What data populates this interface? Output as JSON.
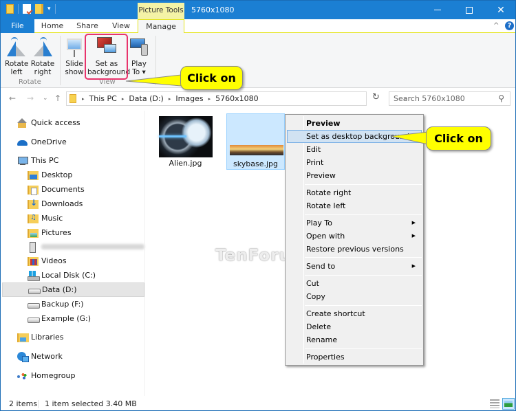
{
  "window": {
    "title": "5760x1080",
    "contextual_tab_group": "Picture Tools",
    "controls": {
      "minimize": "minimize",
      "maximize": "maximize",
      "close": "✕"
    }
  },
  "quick_access_toolbar": {
    "dropdown": "▾"
  },
  "ribbon": {
    "tabs": [
      {
        "label": "File"
      },
      {
        "label": "Home"
      },
      {
        "label": "Share"
      },
      {
        "label": "View"
      },
      {
        "label": "Manage",
        "active": true
      }
    ],
    "collapse_glyph": "^",
    "help_glyph": "?",
    "groups": [
      {
        "label": "Rotate",
        "buttons": [
          {
            "line1": "Rotate",
            "line2": "left",
            "icon": "rotate-left-icon"
          },
          {
            "line1": "Rotate",
            "line2": "right",
            "icon": "rotate-right-icon"
          }
        ]
      },
      {
        "label": "View",
        "buttons": [
          {
            "line1": "Slide",
            "line2": "show",
            "icon": "slideshow-icon"
          },
          {
            "line1": "Set as",
            "line2": "background",
            "icon": "set-background-icon",
            "highlighted": true
          },
          {
            "line1": "Play",
            "line2": "To ▾",
            "icon": "play-to-icon"
          }
        ]
      }
    ]
  },
  "callouts": [
    {
      "text": "Click on",
      "target": "Set as background"
    },
    {
      "text": "Click on",
      "target": "Set as desktop background"
    }
  ],
  "navigation": {
    "back": "←",
    "forward": "→",
    "recent": "⌄",
    "up": "↑",
    "breadcrumb": [
      "This PC",
      "Data (D:)",
      "Images",
      "5760x1080"
    ],
    "crumb_separator": "▸",
    "address_dropdown": "⌄",
    "refresh": "↻",
    "search_placeholder": "Search 5760x1080",
    "search_glyph": "⚲"
  },
  "nav_pane": {
    "items": [
      {
        "label": "Quick access",
        "icon": "quick-access-icon",
        "level": 0
      },
      {
        "label": "OneDrive",
        "icon": "onedrive-icon",
        "level": 0
      },
      {
        "label": "This PC",
        "icon": "this-pc-icon",
        "level": 0
      },
      {
        "label": "Desktop",
        "icon": "desktop-folder-icon",
        "level": 1
      },
      {
        "label": "Documents",
        "icon": "documents-folder-icon",
        "level": 1
      },
      {
        "label": "Downloads",
        "icon": "downloads-folder-icon",
        "level": 1
      },
      {
        "label": "Music",
        "icon": "music-folder-icon",
        "level": 1
      },
      {
        "label": "Pictures",
        "icon": "pictures-folder-icon",
        "level": 1
      },
      {
        "label": "",
        "icon": "phone-device-icon",
        "level": 1,
        "blurred": true
      },
      {
        "label": "Videos",
        "icon": "videos-folder-icon",
        "level": 1
      },
      {
        "label": "Local Disk (C:)",
        "icon": "local-disk-icon",
        "level": 1
      },
      {
        "label": "Data (D:)",
        "icon": "drive-icon",
        "level": 1,
        "selected": true
      },
      {
        "label": "Backup (F:)",
        "icon": "drive-icon",
        "level": 1
      },
      {
        "label": "Example (G:)",
        "icon": "drive-icon",
        "level": 1
      },
      {
        "label": "Libraries",
        "icon": "libraries-icon",
        "level": 0
      },
      {
        "label": "Network",
        "icon": "network-icon",
        "level": 0
      },
      {
        "label": "Homegroup",
        "icon": "homegroup-icon",
        "level": 0
      }
    ]
  },
  "files": [
    {
      "name": "Alien.jpg",
      "selected": false
    },
    {
      "name": "skybase.jpg",
      "selected": true
    }
  ],
  "context_menu": {
    "items": [
      {
        "label": "Preview",
        "bold": true
      },
      {
        "label": "Set as desktop background",
        "hover": true
      },
      {
        "label": "Edit"
      },
      {
        "label": "Print"
      },
      {
        "label": "Preview"
      },
      {
        "separator": true
      },
      {
        "label": "Rotate right"
      },
      {
        "label": "Rotate left"
      },
      {
        "separator": true
      },
      {
        "label": "Play To",
        "submenu": true
      },
      {
        "label": "Open with",
        "submenu": true
      },
      {
        "label": "Restore previous versions"
      },
      {
        "separator": true
      },
      {
        "label": "Send to",
        "submenu": true
      },
      {
        "separator": true
      },
      {
        "label": "Cut"
      },
      {
        "label": "Copy"
      },
      {
        "separator": true
      },
      {
        "label": "Create shortcut"
      },
      {
        "label": "Delete"
      },
      {
        "label": "Rename"
      },
      {
        "separator": true
      },
      {
        "label": "Properties"
      }
    ],
    "submenu_glyph": "▶"
  },
  "watermark": "TenForums.com",
  "status_bar": {
    "item_count": "2 items",
    "selection": "1 item selected  3.40 MB"
  },
  "colors": {
    "titlebar": "#1b7fd3",
    "contextual_tab": "#f4f3a6",
    "highlight_box": "#e8336c",
    "callout": "#ffff00",
    "selection": "#cce8ff",
    "menu_hover": "#d1e2f2"
  }
}
